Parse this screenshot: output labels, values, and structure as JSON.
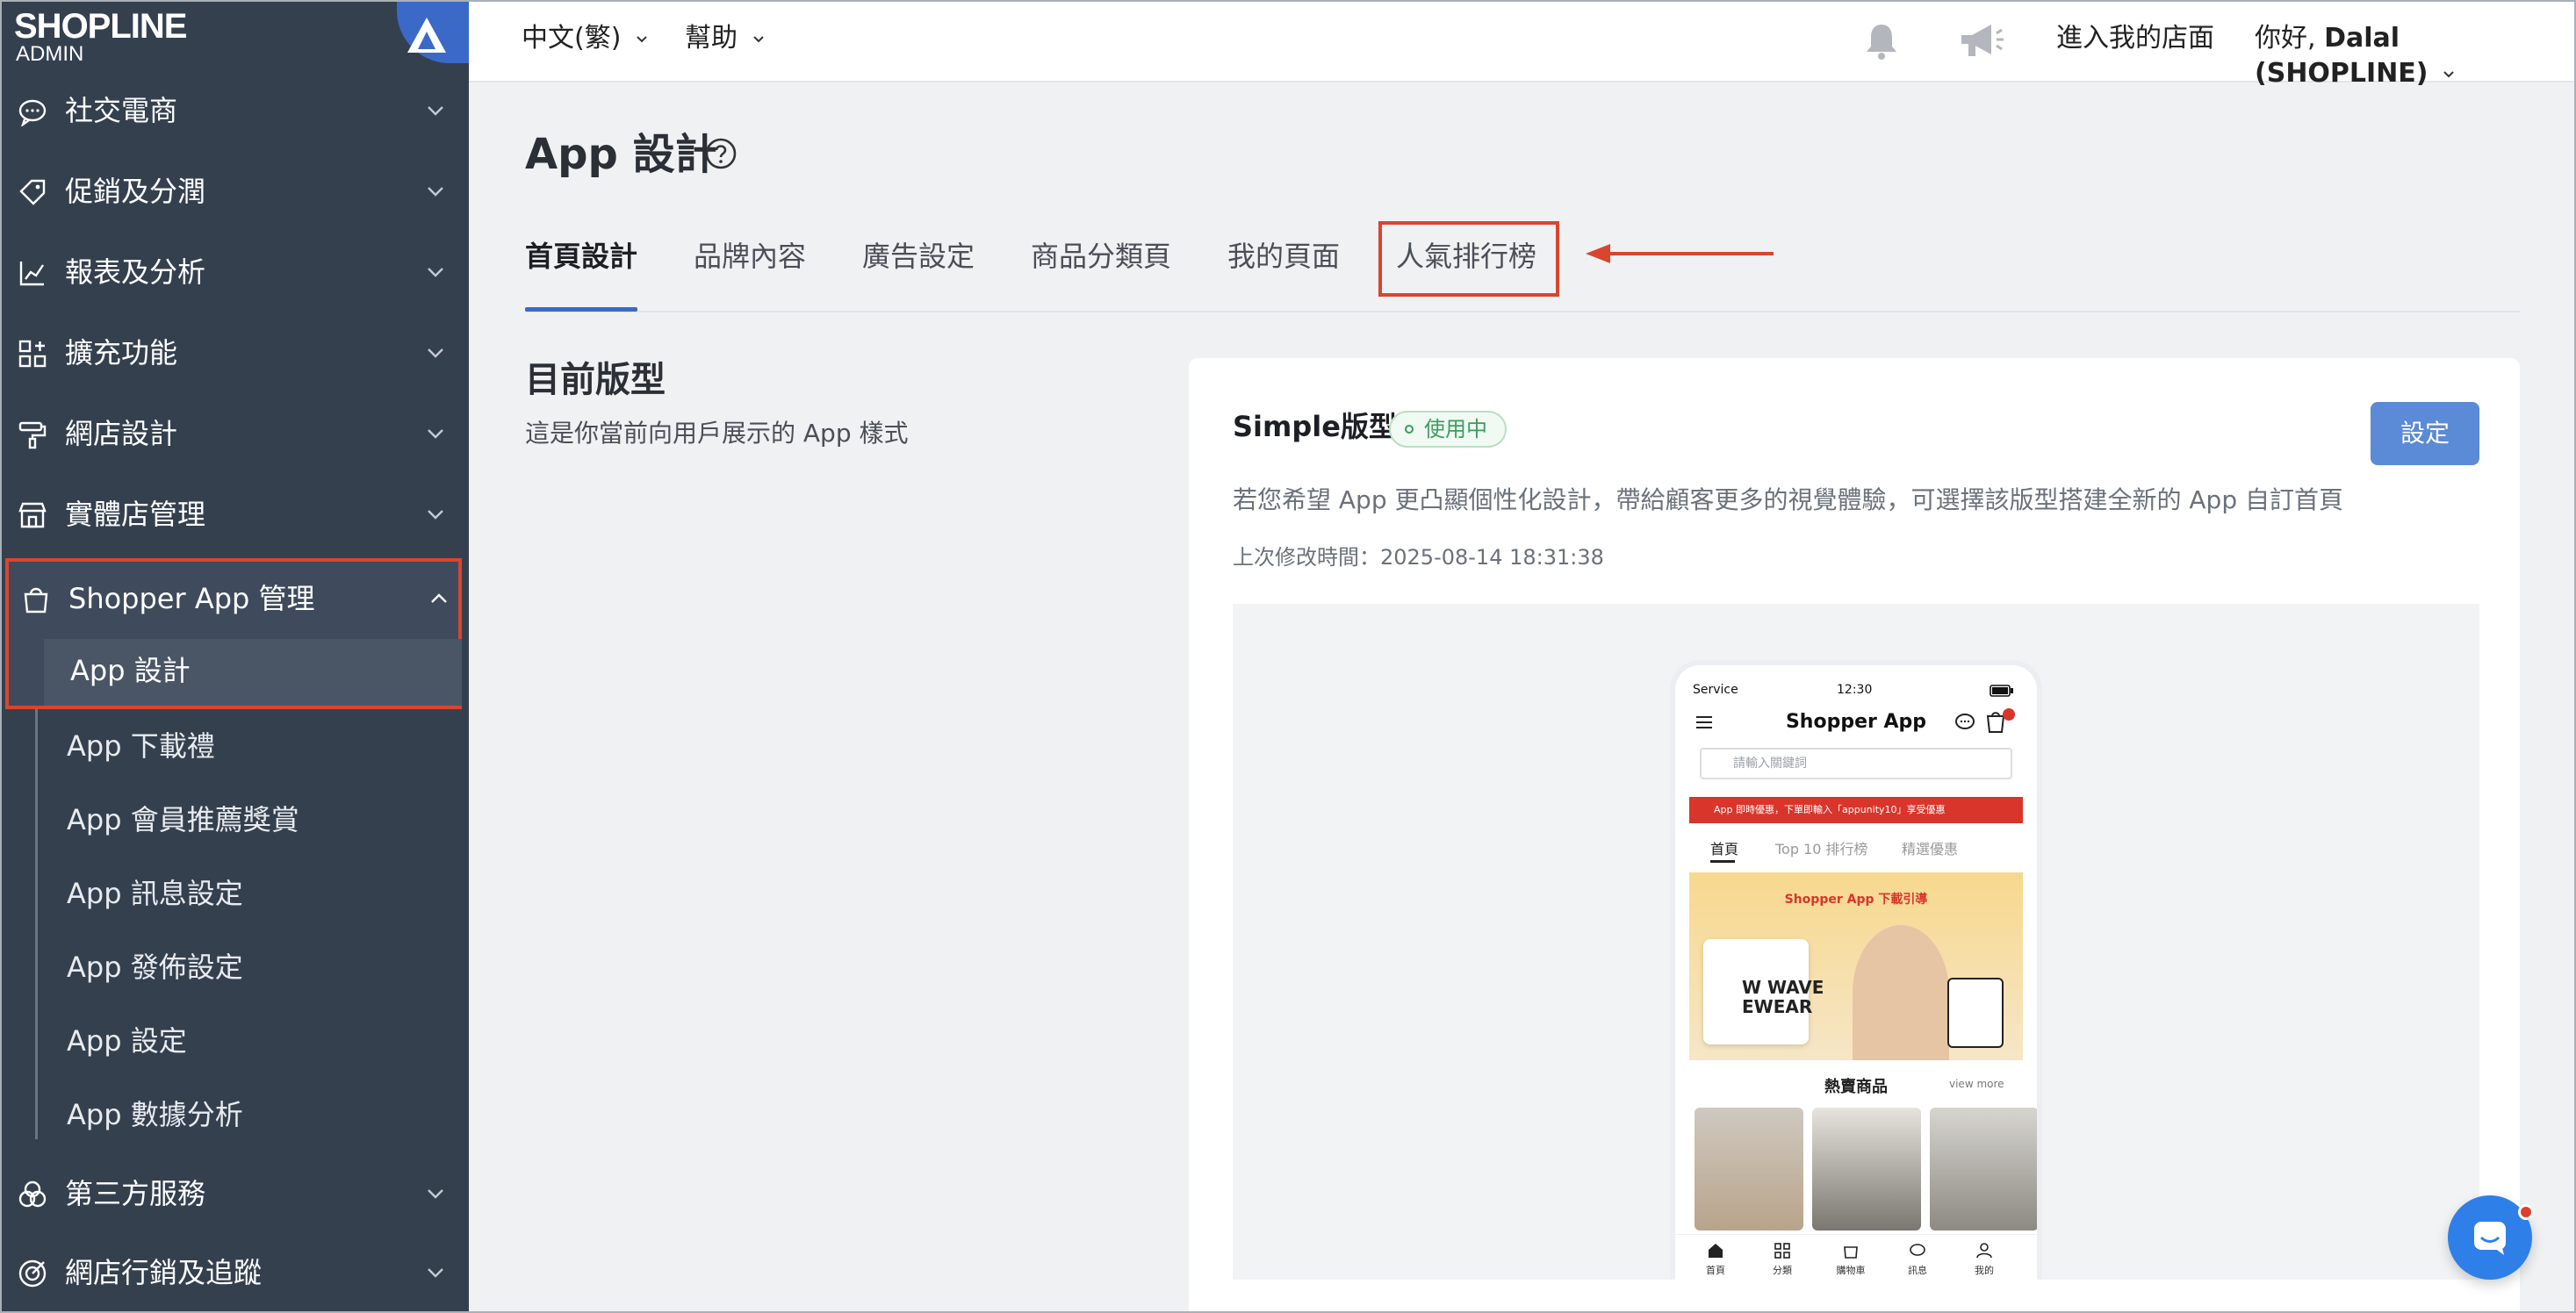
{
  "brand": {
    "logo_text": "SHOPLINE",
    "logo_sub": "ADMIN"
  },
  "sidebar": {
    "items": [
      {
        "label": "社交電商",
        "icon": "chat-bubble-icon"
      },
      {
        "label": "促銷及分潤",
        "icon": "tag-icon"
      },
      {
        "label": "報表及分析",
        "icon": "chart-icon"
      },
      {
        "label": "擴充功能",
        "icon": "puzzle-grid-icon"
      },
      {
        "label": "網店設計",
        "icon": "paint-roller-icon"
      },
      {
        "label": "實體店管理",
        "icon": "store-icon"
      },
      {
        "label": "Shopper App 管理",
        "icon": "shopping-bag-icon"
      },
      {
        "label": "第三方服務",
        "icon": "circles-icon"
      },
      {
        "label": "網店行銷及追蹤",
        "icon": "target-icon"
      }
    ],
    "shopper_sub": [
      "App 設計",
      "App 下載禮",
      "App 會員推薦獎賞",
      "App 訊息設定",
      "App 發佈設定",
      "App 設定",
      "App 數據分析"
    ]
  },
  "topbar": {
    "language": "中文(繁)",
    "help": "幫助",
    "enter_store": "進入我的店面",
    "greeting": "你好, ",
    "user": "Dalal (SHOPLINE)"
  },
  "main": {
    "title": "App 設計",
    "tabs": [
      "首頁設計",
      "品牌內容",
      "廣告設定",
      "商品分類頁",
      "我的頁面",
      "人氣排行榜"
    ],
    "active_tab": "首頁設計",
    "section_title": "目前版型",
    "section_desc": "這是你當前向用戶展示的 App 樣式"
  },
  "card": {
    "title": "Simple版型",
    "status": "使用中",
    "settings_button": "設定",
    "description": "若您希望 App 更凸顯個性化設計，帶給顧客更多的視覺體驗，可選擇該版型搭建全新的 App 自訂首頁",
    "modified": "上次修改時間：2025-08-14 18:31:38"
  },
  "phone": {
    "carrier": "Service",
    "time": "12:30",
    "title": "Shopper App",
    "search_placeholder": "請輸入關鍵詞",
    "banner": "App 即時優惠，下單即輸入「appunity10」享受優惠",
    "tabs": [
      "首頁",
      "Top 10 排行榜",
      "精選優惠"
    ],
    "hero_title": "Shopper App 下載引導",
    "hero_text": "W WAVE\nEWEAR",
    "section": "熱賣商品",
    "view_more": "view more",
    "nav": [
      "首頁",
      "分類",
      "購物車",
      "訊息",
      "我的"
    ]
  },
  "colors": {
    "sidebar_bg": "#35404f",
    "accent": "#3b69c7",
    "highlight_red": "#d9452e",
    "button_blue": "#5b8ad6",
    "status_green": "#3a9d5d"
  }
}
